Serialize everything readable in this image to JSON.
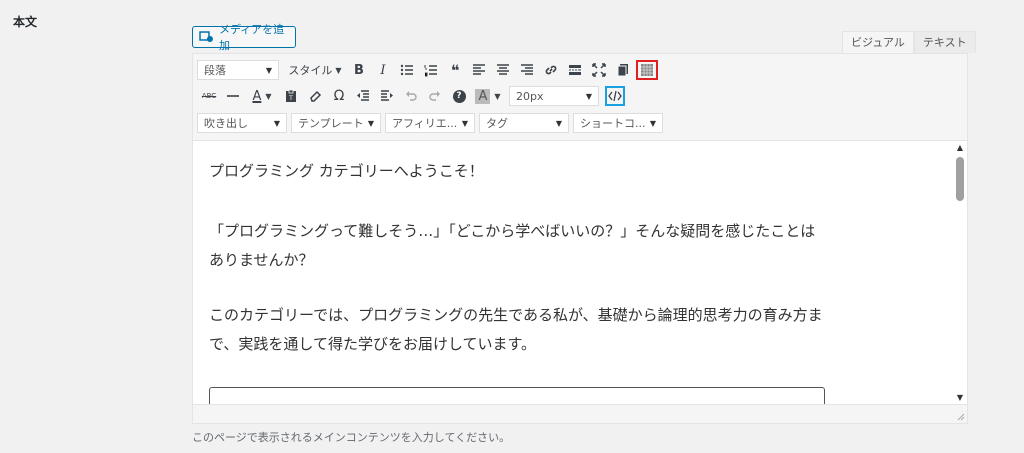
{
  "section": {
    "label": "本文"
  },
  "media_button": {
    "label": "メディアを追加",
    "icon": "media-icon"
  },
  "tabs": [
    {
      "label": "ビジュアル",
      "active": true
    },
    {
      "label": "テキスト",
      "active": false
    }
  ],
  "toolbar": {
    "format_select": "段落",
    "style_select": "スタイル",
    "font_size_select": "20px",
    "speech_select": "吹き出し",
    "template_select": "テンプレート",
    "affiliate_select": "アフィリエ...",
    "tag_select": "タグ",
    "shortcode_select": "ショートコ...",
    "bold": "B",
    "italic": "I",
    "quote": "❝",
    "text_color_letter": "A",
    "bg_color_letter": "A",
    "strike": "ABC",
    "omega": "Ω",
    "help": "?"
  },
  "content": {
    "paragraphs": [
      "プログラミング カテゴリーへようこそ！",
      "「プログラミングって難しそう…」「どこから学べばいいの？」そんな疑問を感じたことはありませんか？",
      "このカテゴリーでは、プログラミングの先生である私が、基礎から論理的思考力の育み方まで、実践を通して得た学びをお届けしています。"
    ]
  },
  "help_text": "このページで表示されるメインコンテンツを入力してください。",
  "colors": {
    "accent": "#0073aa",
    "highlight_red": "#e02020",
    "highlight_blue": "#1aa0e0"
  }
}
